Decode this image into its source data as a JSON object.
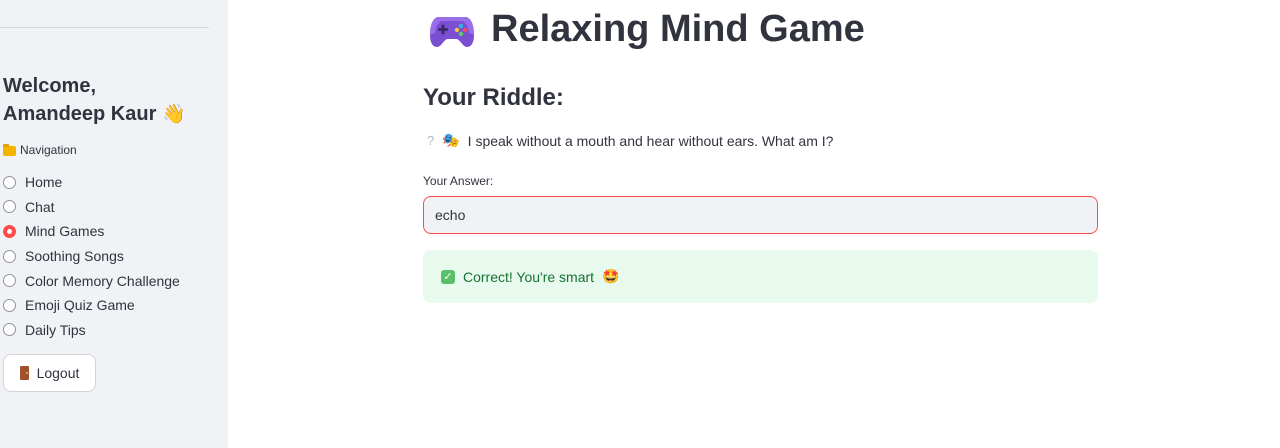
{
  "sidebar": {
    "welcome_line1": "Welcome,",
    "welcome_line2": "Amandeep Kaur",
    "wave_emoji": "👋",
    "nav_label": "Navigation",
    "nav_items": [
      {
        "label": "Home",
        "selected": false
      },
      {
        "label": "Chat",
        "selected": false
      },
      {
        "label": "Mind Games",
        "selected": true
      },
      {
        "label": "Soothing Songs",
        "selected": false
      },
      {
        "label": "Color Memory Challenge",
        "selected": false
      },
      {
        "label": "Emoji Quiz Game",
        "selected": false
      },
      {
        "label": "Daily Tips",
        "selected": false
      }
    ],
    "logout_label": "Logout"
  },
  "main": {
    "title": "Relaxing Mind Game",
    "subtitle": "Your Riddle:",
    "riddle_prefix": "?",
    "riddle_emoji": "🎭",
    "riddle_text": "I speak without a mouth and hear without ears. What am I?",
    "answer_label": "Your Answer:",
    "answer_value": "echo",
    "success_text": "Correct! You're smart",
    "success_emoji": "🤩"
  },
  "colors": {
    "accent": "#ff4b4b",
    "sidebar_bg": "#f0f2f6",
    "success_bg": "#e8f9ee",
    "success_text": "#177233"
  }
}
